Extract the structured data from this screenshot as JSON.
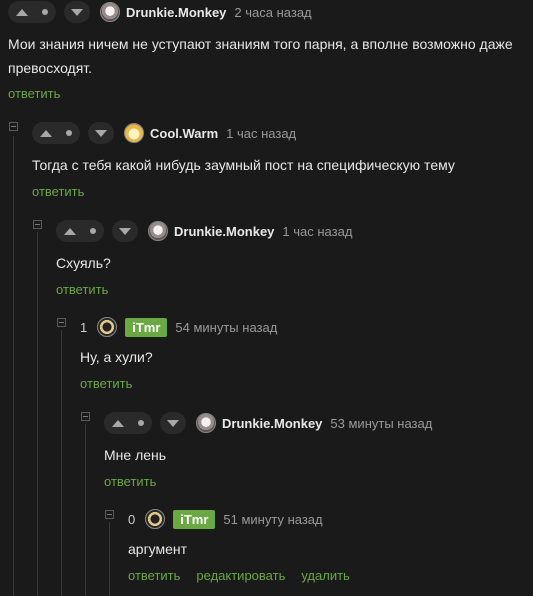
{
  "comments": [
    {
      "author": "Drunkie.Monkey",
      "time": "2 часа назад",
      "text": "Мои знания ничем не уступают знаниям того парня, а вполне возможно даже превосходят.",
      "reply": "ответить"
    },
    {
      "author": "Cool.Warm",
      "time": "1 час назад",
      "text": "Тогда с тебя какой нибудь заумный пост на специфическую тему",
      "reply": "ответить"
    },
    {
      "author": "Drunkie.Monkey",
      "time": "1 час назад",
      "text": "Схуяль?",
      "reply": "ответить"
    },
    {
      "score": "1",
      "author": "iTmr",
      "time": "54 минуты назад",
      "text": "Ну, а хули?",
      "reply": "ответить"
    },
    {
      "author": "Drunkie.Monkey",
      "time": "53 минуты назад",
      "text": "Мне лень",
      "reply": "ответить"
    },
    {
      "score": "0",
      "author": "iTmr",
      "time": "51 минуту назад",
      "text": "аргумент",
      "reply": "ответить",
      "edit": "редактировать",
      "delete": "удалить"
    }
  ],
  "colors": {
    "accent": "#6aa843",
    "background": "#1a1a1a"
  }
}
